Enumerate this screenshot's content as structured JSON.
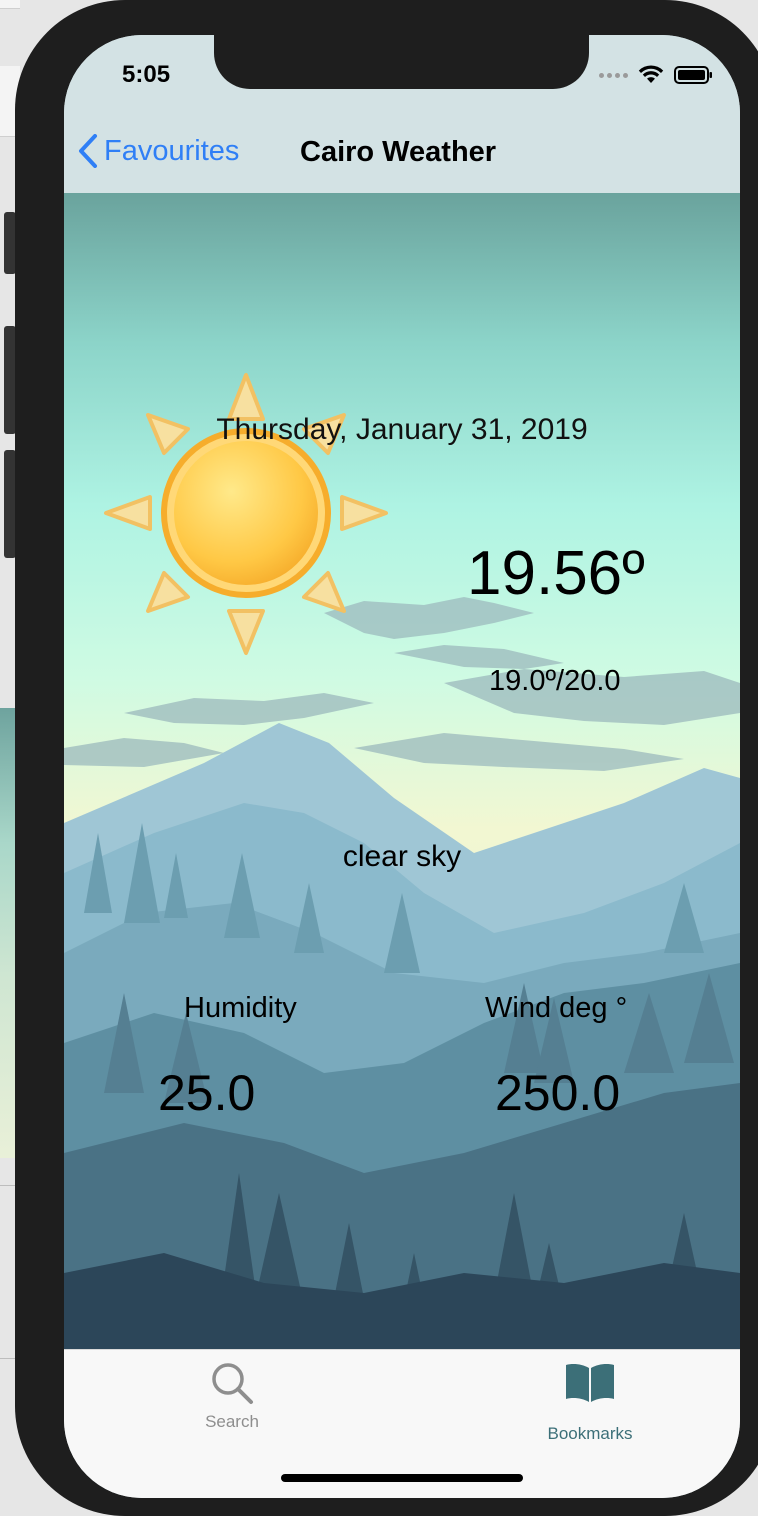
{
  "status": {
    "time": "5:05"
  },
  "nav": {
    "back_label": "Favourites",
    "title": "Cairo Weather"
  },
  "weather": {
    "date": "Thursday, January 31, 2019",
    "temperature": "19.56º",
    "range": "19.0º/20.0",
    "description": "clear sky",
    "humidity_label": "Humidity",
    "humidity_value": "25.0",
    "wind_label": "Wind deg °",
    "wind_value": "250.0"
  },
  "tabs": {
    "search_label": "Search",
    "bookmarks_label": "Bookmarks"
  },
  "colors": {
    "tint": "#2f7ff6",
    "active_tab": "#3c6f78",
    "inactive_tab": "#8e8e8e"
  }
}
